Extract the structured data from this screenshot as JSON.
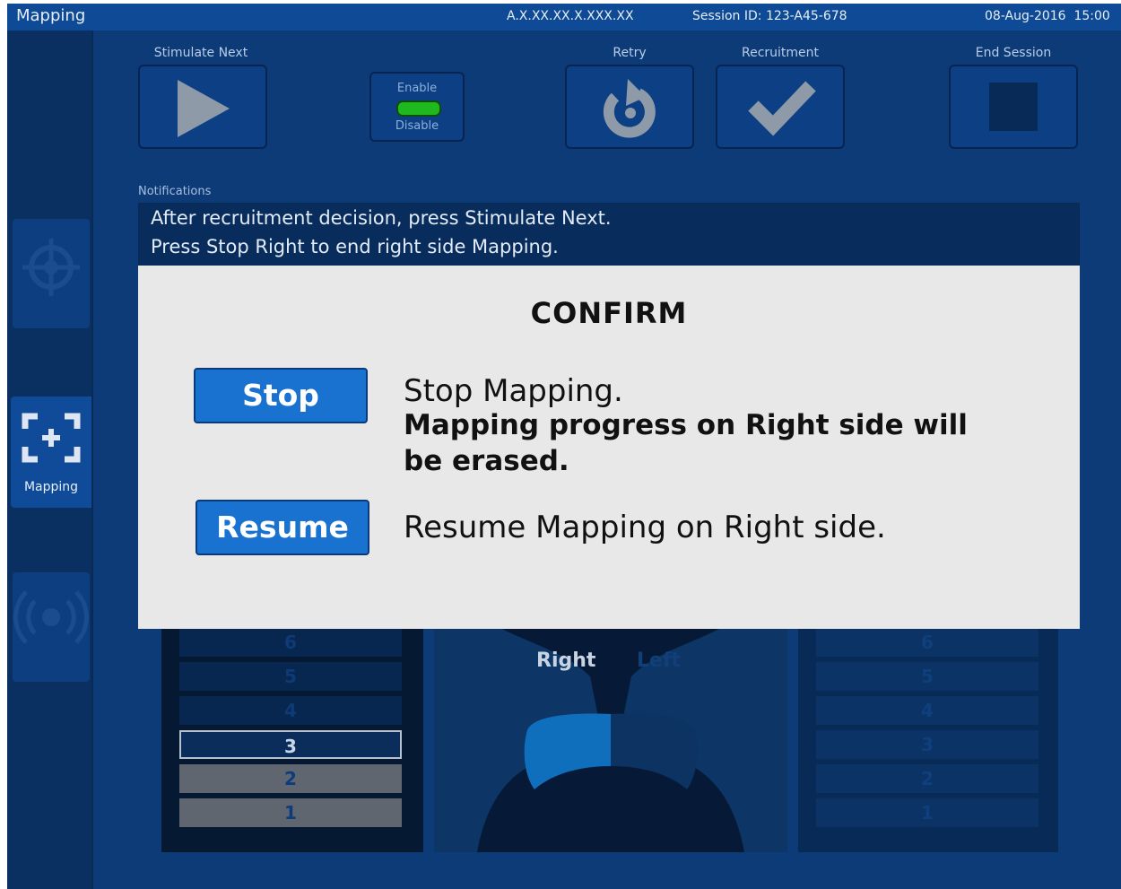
{
  "topbar": {
    "app_title": "Mapping",
    "device_id": "A.X.XX.XX.X.XXX.XX",
    "session": "Session ID: 123-A45-678",
    "datetime": "08-Aug-2016  15:00"
  },
  "sidebar": {
    "active_label": "Mapping"
  },
  "toolbar": {
    "stimulate_next_label": "Stimulate Next",
    "enable_label": "Enable",
    "disable_label": "Disable",
    "retry_label": "Retry",
    "recruitment_label": "Recruitment",
    "end_session_label": "End Session"
  },
  "notifications": {
    "label": "Notifications",
    "line1": "After recruitment decision, press Stimulate Next.",
    "line2": "Press Stop Right to end right side Mapping."
  },
  "modal": {
    "title": "CONFIRM",
    "stop_button": "Stop",
    "stop_text": "Stop Mapping.",
    "stop_warning_line1": "Mapping progress on Right side will",
    "stop_warning_line2": "be erased.",
    "resume_button": "Resume",
    "resume_text": "Resume Mapping on Right side."
  },
  "lungs": {
    "right_label": "Right",
    "left_label": "Left"
  },
  "left_levels": [
    "6",
    "5",
    "4",
    "3",
    "2",
    "1"
  ],
  "right_levels": [
    "6",
    "5",
    "4",
    "3",
    "2",
    "1"
  ],
  "colors": {
    "app_bg": "#0c3b78",
    "topbar_bg": "#0e4a95",
    "modal_bg": "#e8e8e8",
    "modal_button": "#1a72d0",
    "toggle_on": "#1fb81f"
  }
}
